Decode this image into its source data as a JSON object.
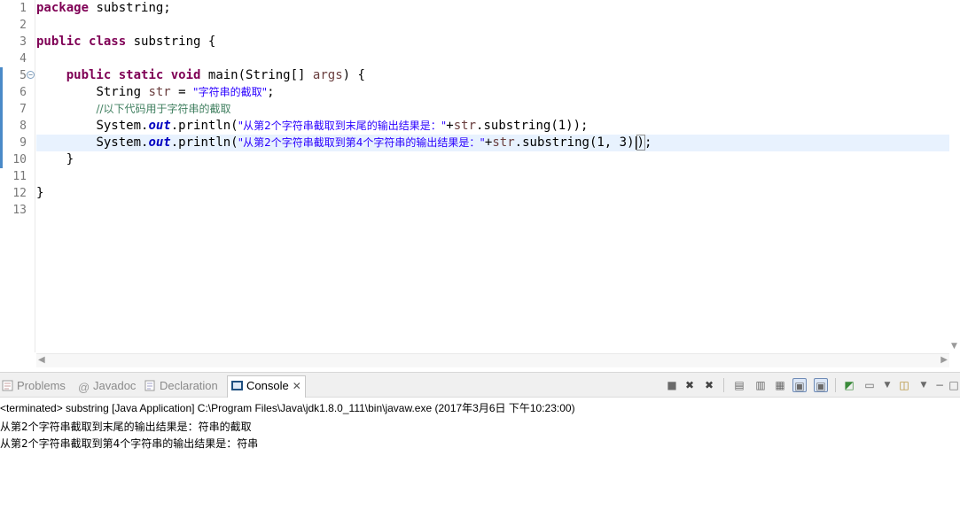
{
  "editor": {
    "line_numbers": [
      "1",
      "2",
      "3",
      "4",
      "5",
      "6",
      "7",
      "8",
      "9",
      "10",
      "11",
      "12",
      "13"
    ],
    "tokens": {
      "package_kw": "package",
      "package_name": " substring;",
      "public_kw": "public",
      "class_kw": "class",
      "class_name": " substring {",
      "static_kw": "static",
      "void_kw": "void",
      "main_sig": " main(String[] ",
      "args": "args",
      "main_open": ") {",
      "string_type": "String ",
      "str_var": "str",
      "assign": " = ",
      "str_literal": "\"字符串的截取\"",
      "semicolon": ";",
      "comment": "//以下代码用于字符串的截取",
      "system": "System.",
      "out": "out",
      "println_open": ".println(",
      "literal1": "\"从第2个字符串截取到末尾的输出结果是：\"",
      "concat": "+",
      "substring1": ".substring(1));",
      "literal2": "\"从第2个字符串截取到第4个字符串的输出结果是：\"",
      "substring2_a": ".substring(1, 3)",
      "close_paren": ")",
      "substring2_end": ";",
      "close_brace_method": "}",
      "close_brace_class": "}"
    }
  },
  "panel": {
    "tabs": [
      {
        "label": "Problems"
      },
      {
        "label": "Javadoc"
      },
      {
        "label": "Declaration"
      },
      {
        "label": "Console"
      }
    ],
    "console": {
      "header": "<terminated> substring [Java Application] C:\\Program Files\\Java\\jdk1.8.0_111\\bin\\javaw.exe (2017年3月6日 下午10:23:00)",
      "output": [
        "从第2个字符串截取到末尾的输出结果是：符串的截取",
        "从第2个字符串截取到第4个字符串的输出结果是：符串"
      ]
    }
  },
  "colors": {
    "keyword": "#7f0055",
    "string": "#2a00ff",
    "comment": "#3f7f5f",
    "field": "#0000c0",
    "current_line": "#e8f2fe"
  }
}
